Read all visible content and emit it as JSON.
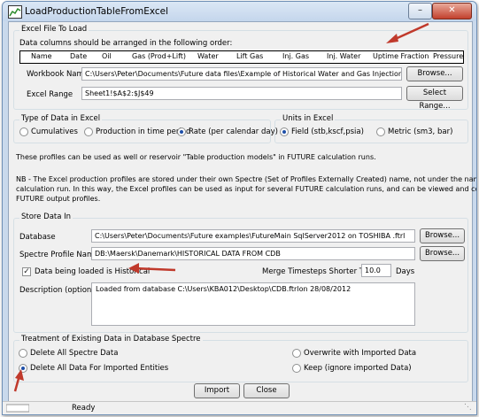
{
  "window": {
    "title": "LoadProductionTableFromExcel",
    "status": "Ready"
  },
  "excel": {
    "group_title": "Excel File To Load",
    "instruction": "Data columns should be arranged in the following order:",
    "columns": [
      "Name",
      "Date",
      "Oil",
      "Gas (Prod+Lift)",
      "Water",
      "Lift Gas",
      "Inj. Gas",
      "Inj. Water",
      "Uptime Fraction",
      "Pressure"
    ],
    "workbook_label": "Workbook Name",
    "workbook_value": "C:\\Users\\Peter\\Documents\\Future data files\\Example of Historical Water and Gas Injection Data.xlsx",
    "browse_label": "Browse...",
    "range_label": "Excel Range",
    "range_value": "Sheet1!$A$2:$J$49",
    "select_range_label": "Select Range..."
  },
  "data_type": {
    "group_title": "Type of Data in Excel",
    "options": [
      "Cumulatives",
      "Production in time period",
      "Rate (per calendar day)"
    ],
    "selected": "Rate (per calendar day)"
  },
  "units": {
    "group_title": "Units in Excel",
    "options": [
      "Field (stb,kscf,psia)",
      "Metric (sm3, bar)"
    ],
    "selected": "Field (stb,kscf,psia)"
  },
  "info": {
    "line1": "These profiles can be used as well or reservoir \"Table production models\" in FUTURE calculation runs.",
    "line2a": "NB - The Excel production profiles are stored under their own Spectre (Set of Profiles Externally Created) name, not under the name of a FUTURE",
    "line2b": "calculation run. In this way, the Excel profiles can be used as input for several FUTURE calculation runs, and can be viewed and compared with",
    "line2c": "FUTURE output profiles."
  },
  "store": {
    "group_title": "Store Data In",
    "database_label": "Database",
    "database_value": "C:\\Users\\Peter\\Documents\\Future examples\\FutureMain SqlServer2012 on TOSHIBA .ftrl",
    "spectre_label": "Spectre Profile Name",
    "spectre_value": "DB:\\Maersk\\Danemark\\HISTORICAL DATA FROM CDB",
    "browse_label": "Browse...",
    "historical_label": "Data being loaded is Historical",
    "historical_checked": true,
    "merge_label": "Merge Timesteps Shorter Than",
    "merge_value": "10.0",
    "merge_unit": "Days",
    "description_label": "Description (optional)",
    "description_value": "Loaded from database C:\\Users\\KBA012\\Desktop\\CDB.ftrlon 28/08/2012"
  },
  "treatment": {
    "group_title": "Treatment of Existing Data in Database Spectre",
    "opt_delete_all": "Delete All Spectre Data",
    "opt_delete_imported": "Delete All Data For Imported Entities",
    "opt_overwrite": "Overwrite with Imported Data",
    "opt_keep": "Keep (ignore imported Data)",
    "selected": "Delete All Data For Imported Entities"
  },
  "actions": {
    "import_label": "Import",
    "close_label": "Close"
  },
  "colors": {
    "annotation_arrow": "#c0392b",
    "radio_dot": "#1e4fa8",
    "title_bar": "#c4d6ec"
  }
}
